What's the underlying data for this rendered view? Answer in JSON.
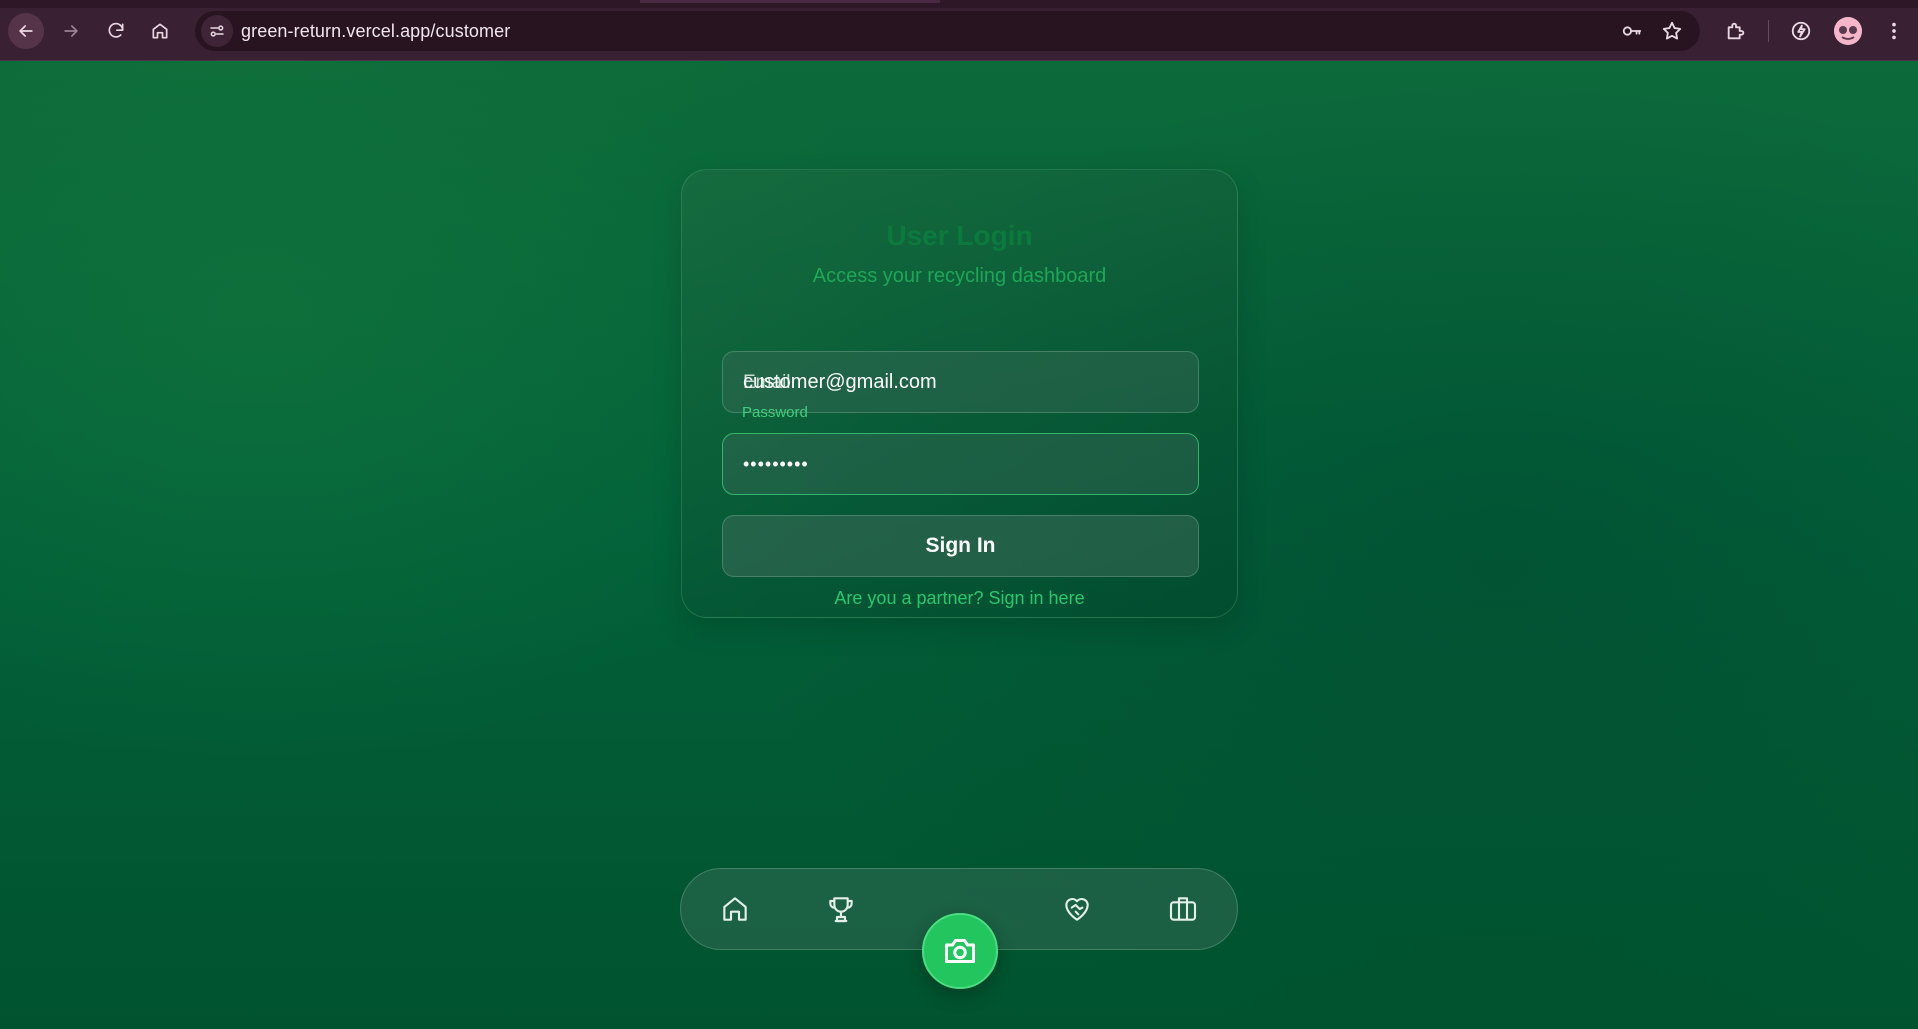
{
  "browser": {
    "url": "green-return.vercel.app/customer",
    "icons": [
      "back-icon",
      "forward-icon",
      "reload-icon",
      "home-icon",
      "site-info-icon",
      "key-icon",
      "star-icon",
      "extensions-icon",
      "performance-icon",
      "avatar",
      "menu-icon"
    ]
  },
  "login": {
    "title": "User Login",
    "subtitle": "Access your recycling dashboard",
    "email_label": "Email",
    "email_value": "customer@gmail.com",
    "password_label": "Password",
    "password_value": "•••••••••",
    "signin_label": "Sign In",
    "partner_link": "Are you a partner? Sign in here"
  },
  "bottom_nav": {
    "items": [
      "home-icon",
      "trophy-icon",
      "camera-icon",
      "heart-handshake-icon",
      "briefcase-icon"
    ]
  },
  "colors": {
    "accent": "#22c55e",
    "title": "#0b7a3c",
    "link": "#2bc66c",
    "chrome": "#3a2033"
  }
}
